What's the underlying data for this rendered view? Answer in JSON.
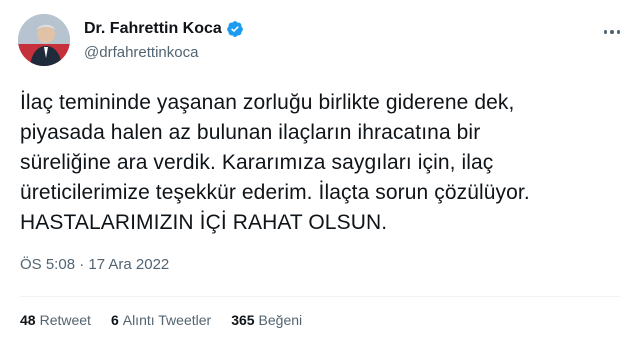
{
  "author": {
    "display_name": "Dr. Fahrettin Koca",
    "handle": "@drfahrettinkoca",
    "verified": true
  },
  "tweet": {
    "lines": [
      "İlaç temininde yaşanan zorluğu birlikte giderene dek,",
      "piyasada halen az bulunan ilaçların ihracatına bir",
      "süreliğine ara verdik. Kararımıza saygıları için, ilaç",
      "üreticilerimize teşekkür ederim. İlaçta sorun çözülüyor.",
      "HASTALARIMIZIN İÇİ RAHAT OLSUN."
    ],
    "timestamp": "ÖS 5:08 · 17 Ara 2022"
  },
  "stats": {
    "retweets_count": "48",
    "retweets_label": "Retweet",
    "quotes_count": "6",
    "quotes_label": "Alıntı Tweetler",
    "likes_count": "365",
    "likes_label": "Beğeni"
  },
  "colors": {
    "verified_badge": "#1d9bf0",
    "secondary_text": "#536471",
    "primary_text": "#0f1419"
  },
  "icons": {
    "verified": "verified-badge-icon",
    "more": "more-options-icon"
  }
}
